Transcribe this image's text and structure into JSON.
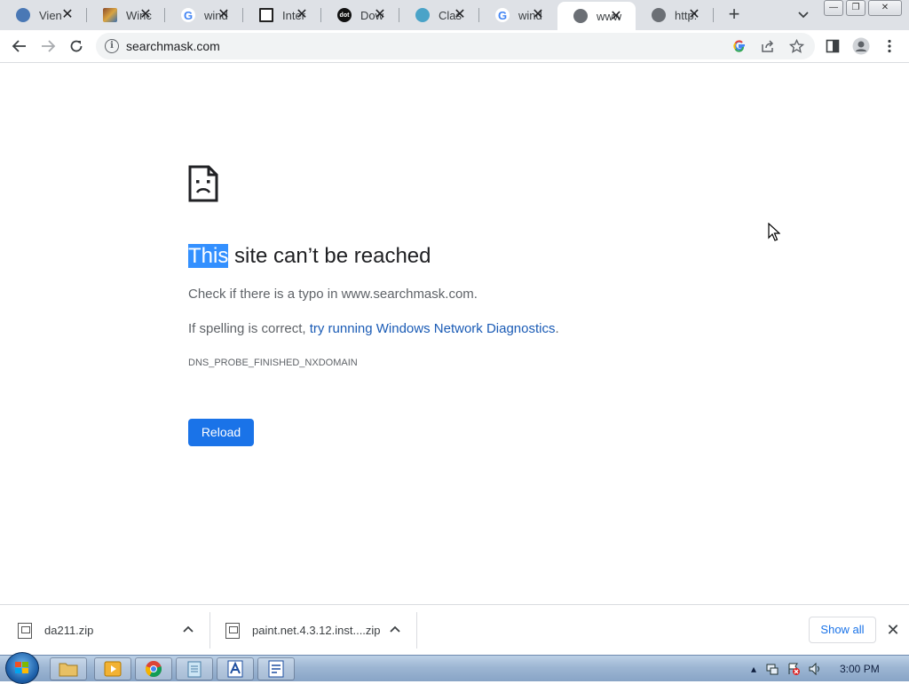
{
  "tabs": [
    {
      "title": "Vien",
      "icon": "globe-blue-icon",
      "color": "#4a78b5"
    },
    {
      "title": "Winc",
      "icon": "winrar-icon",
      "color": "#8b4a2b"
    },
    {
      "title": "wind",
      "icon": "google-icon",
      "color": "#4285f4"
    },
    {
      "title": "Inter",
      "icon": "internet-archive-icon",
      "color": "#222222"
    },
    {
      "title": "Dow",
      "icon": "dot-icon",
      "color": "#111111"
    },
    {
      "title": "Clas",
      "icon": "classic-shell-icon",
      "color": "#4aa3c8"
    },
    {
      "title": "wind",
      "icon": "google-icon",
      "color": "#4285f4"
    },
    {
      "title": "www",
      "icon": "globe-gray-icon",
      "color": "#6b6f75",
      "active": true
    },
    {
      "title": "http:",
      "icon": "globe-gray-icon",
      "color": "#6b6f75"
    }
  ],
  "tab_favicon_text": {
    "dot": "dot",
    "google": "G"
  },
  "address": {
    "url": "searchmask.com"
  },
  "error_page": {
    "headline_highlight": "This",
    "headline_rest": " site can’t be reached",
    "check_text": "Check if there is a typo in www.searchmask.com.",
    "spelling_prefix": "If spelling is correct, ",
    "diagnostics_link": "try running Windows Network Diagnostics",
    "spelling_suffix": ".",
    "error_code": "DNS_PROBE_FINISHED_NXDOMAIN",
    "reload_label": "Reload"
  },
  "downloads": {
    "items": [
      {
        "name": "da211.zip"
      },
      {
        "name": "paint.net.4.3.12.inst....zip"
      }
    ],
    "show_all_label": "Show all"
  },
  "taskbar": {
    "clock": "3:00 PM"
  },
  "colors": {
    "accent": "#1a73e8",
    "link": "#1a5bb5",
    "selection": "#3390ff"
  }
}
